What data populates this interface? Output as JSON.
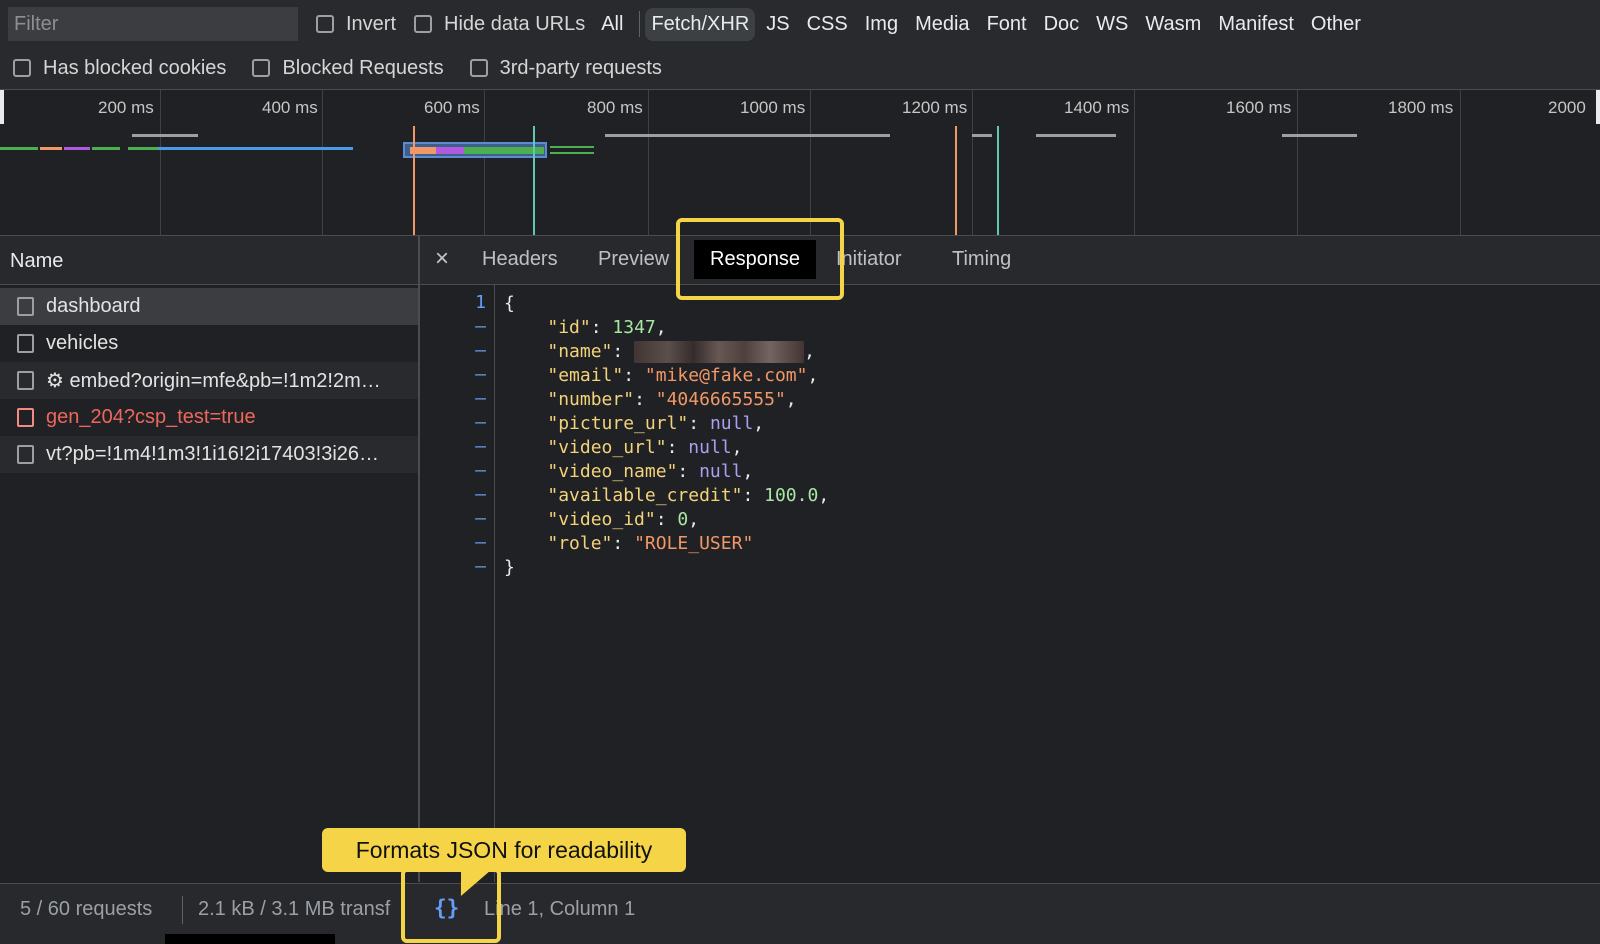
{
  "filter": {
    "placeholder": "Filter",
    "invert": "Invert",
    "hide_data_urls": "Hide data URLs"
  },
  "types": [
    "All",
    "Fetch/XHR",
    "JS",
    "CSS",
    "Img",
    "Media",
    "Font",
    "Doc",
    "WS",
    "Wasm",
    "Manifest",
    "Other"
  ],
  "active_type": "Fetch/XHR",
  "filters_row2": [
    "Has blocked cookies",
    "Blocked Requests",
    "3rd-party requests"
  ],
  "timeline": {
    "ticks": [
      "200 ms",
      "400 ms",
      "600 ms",
      "800 ms",
      "1000 ms",
      "1200 ms",
      "1400 ms",
      "1600 ms",
      "1800 ms",
      "2000"
    ]
  },
  "requests": {
    "header": "Name",
    "items": [
      {
        "name": "dashboard",
        "selected": true
      },
      {
        "name": "vehicles"
      },
      {
        "name": "⚙ embed?origin=mfe&pb=!1m2!2m…"
      },
      {
        "name": "gen_204?csp_test=true",
        "error": true
      },
      {
        "name": "vt?pb=!1m4!1m3!1i16!2i17403!3i26…"
      }
    ]
  },
  "tabs": {
    "close": "×",
    "headers": "Headers",
    "preview": "Preview",
    "response": "Response",
    "initiator": "Initiator",
    "timing": "Timing",
    "active": "Response"
  },
  "response": {
    "line_numbers": [
      "1",
      "–",
      "–",
      "–",
      "–",
      "–",
      "–",
      "–",
      "–",
      "–",
      "–",
      "–"
    ],
    "open_brace": "{",
    "close_brace": "}",
    "fields": [
      {
        "key": "\"id\"",
        "value": "1347",
        "type": "number"
      },
      {
        "key": "\"name\"",
        "value": "",
        "type": "redacted"
      },
      {
        "key": "\"email\"",
        "value": "\"mike@fake.com\"",
        "type": "string"
      },
      {
        "key": "\"number\"",
        "value": "\"4046665555\"",
        "type": "string"
      },
      {
        "key": "\"picture_url\"",
        "value": "null",
        "type": "null"
      },
      {
        "key": "\"video_url\"",
        "value": "null",
        "type": "null"
      },
      {
        "key": "\"video_name\"",
        "value": "null",
        "type": "null"
      },
      {
        "key": "\"available_credit\"",
        "value": "100.0",
        "type": "number"
      },
      {
        "key": "\"video_id\"",
        "value": "0",
        "type": "number"
      },
      {
        "key": "\"role\"",
        "value": "\"ROLE_USER\"",
        "type": "string"
      }
    ]
  },
  "status": {
    "requests": "5 / 60 requests",
    "transferred": "2.1 kB / 3.1 MB transf",
    "pretty_print": "{}",
    "cursor": "Line 1, Column 1"
  },
  "callout": {
    "text": "Formats JSON for readability"
  },
  "colors": {
    "highlight": "#f5d547",
    "link_blue": "#669df6",
    "error_red": "#ee675c",
    "key": "#f3d37a",
    "string": "#f29766",
    "number": "#a8e6a3",
    "null": "#a7a1f0"
  }
}
